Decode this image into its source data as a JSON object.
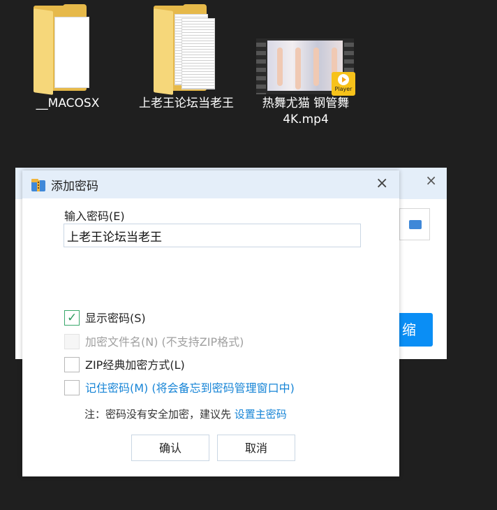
{
  "desktop": {
    "items": [
      {
        "label": "__MACOSX"
      },
      {
        "label": "上老王论坛当老王"
      },
      {
        "label": "热舞尤猫 钢管舞4K.mp4",
        "badge": "Player"
      }
    ]
  },
  "bg_window": {
    "close": "×",
    "compress_label": "缩"
  },
  "dialog": {
    "title": "添加密码",
    "close": "×",
    "password_label": "输入密码(E)",
    "password_value": "上老王论坛当老王",
    "options": [
      {
        "label": "显示密码(S)",
        "checked": true,
        "disabled": false
      },
      {
        "label": "加密文件名(N) (不支持ZIP格式)",
        "checked": false,
        "disabled": true
      },
      {
        "label": "ZIP经典加密方式(L)",
        "checked": false,
        "disabled": false
      },
      {
        "label": "记住密码(M) (将会备忘到密码管理窗口中)",
        "checked": false,
        "disabled": false
      }
    ],
    "note_prefix": "注：密码没有安全加密，建议先 ",
    "note_link": "设置主密码",
    "ok_label": "确认",
    "cancel_label": "取消"
  },
  "colors": {
    "accent": "#0a8ef5",
    "link": "#1684d6",
    "title_bg": "#e4eef9"
  }
}
